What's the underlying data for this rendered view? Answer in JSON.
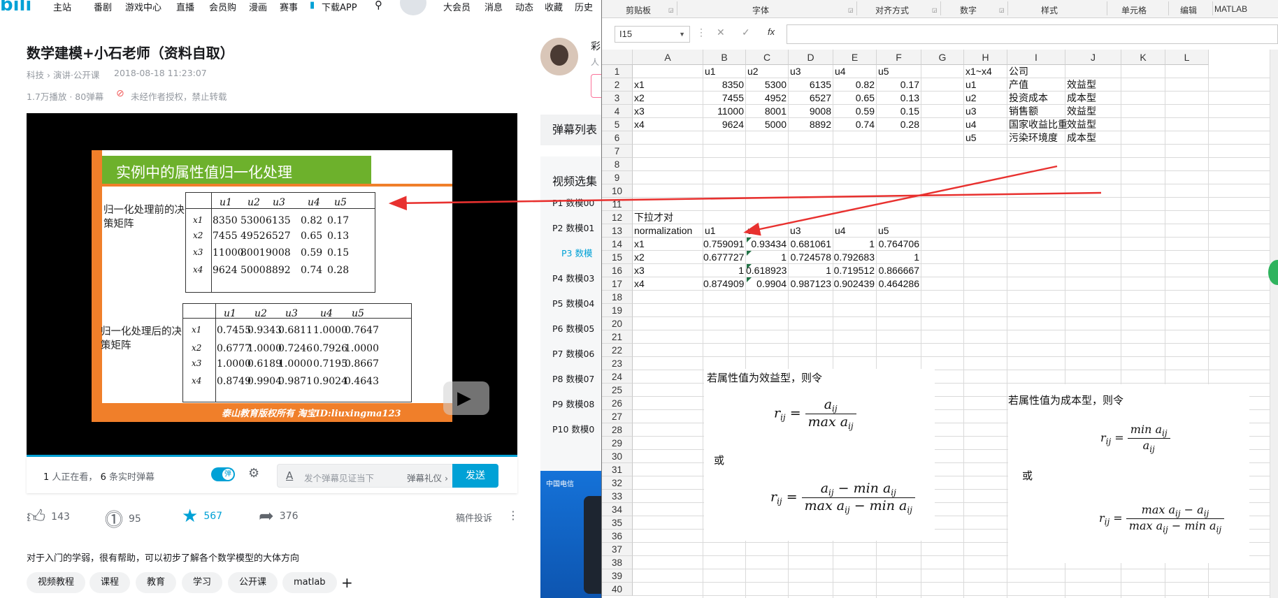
{
  "colors": {
    "accent": "#00a1d6",
    "slide_green": "#6db12c",
    "slide_orange": "#f07f2a",
    "arrow_red": "#e8312f",
    "excel_green": "#217346"
  },
  "nav": {
    "logo": "bili",
    "items": [
      "主站",
      "番剧",
      "游戏中心",
      "直播",
      "会员购",
      "漫画",
      "赛事",
      "下载APP",
      "大会员",
      "消息",
      "动态",
      "收藏",
      "历史"
    ],
    "icons": [
      "phone-icon",
      "search-icon",
      "avatar"
    ]
  },
  "video": {
    "title": "数学建模+小石老师（资料自取）",
    "category": "科技 › 演讲·公开课",
    "date": "2018-08-18 11:23:07",
    "stats": "1.7万播放 · 80弹幕",
    "notice": "未经作者授权，禁止转载"
  },
  "slide": {
    "title": "实例中的属性值归一化处理",
    "label_before": "归一化处理前的决策矩阵",
    "label_after": "归一化处理后的决策矩阵",
    "headers": [
      "u1",
      "u2",
      "u3",
      "u4",
      "u5"
    ],
    "rows": [
      "x1",
      "x2",
      "x3",
      "x4"
    ],
    "before": [
      [
        "8350",
        "5300",
        "6135",
        "0.82",
        "0.17"
      ],
      [
        "7455",
        "4952",
        "6527",
        "0.65",
        "0.13"
      ],
      [
        "11000",
        "8001",
        "9008",
        "0.59",
        "0.15"
      ],
      [
        "9624",
        "5000",
        "8892",
        "0.74",
        "0.28"
      ]
    ],
    "after": [
      [
        "0.7455",
        "0.9343",
        "0.6811",
        "1.0000",
        "0.7647"
      ],
      [
        "0.6777",
        "1.0000",
        "0.7246",
        "0.7926",
        "1.0000"
      ],
      [
        "1.0000",
        "0.6189",
        "1.0000",
        "0.7195",
        "0.8667"
      ],
      [
        "0.8749",
        "0.9904",
        "0.9871",
        "0.9024",
        "0.4643"
      ]
    ],
    "footer": "泰山教育版权所有  淘宝ID:liuxingma123"
  },
  "danmaku": {
    "watching": "1",
    "watching_text": "人正在看，",
    "live": "6",
    "live_text": "条实时弹幕",
    "toggle": "弹",
    "placeholder": "发个弹幕见证当下",
    "gift": "弹幕礼仪 ›",
    "send": "发送"
  },
  "actions": {
    "like": "143",
    "coin": "95",
    "fav": "567",
    "share": "376",
    "report": "稿件投诉"
  },
  "description": "对于入门的学弱，很有帮助，可以初步了解各个数学模型的大体方向",
  "tags": [
    "视频教程",
    "课程",
    "教育",
    "学习",
    "公开课",
    "matlab",
    "+"
  ],
  "right_panel": {
    "up_name": "彩",
    "up_sub": "人",
    "danmaku_list": "弹幕列表",
    "video_select": "视频选集",
    "episodes": [
      "P1  数模00",
      "P2  数模01",
      "P3  数模",
      "P4  数模03",
      "P5  数模04",
      "P6  数模05",
      "P7  数模06",
      "P8  数模07",
      "P9  数模08",
      "P10  数模0"
    ],
    "current_episode": 2,
    "ad_text": "中国电信"
  },
  "excel": {
    "ribbon": [
      "剪贴板",
      "字体",
      "对齐方式",
      "数字",
      "样式",
      "单元格",
      "编辑",
      "MATLAB"
    ],
    "name_box": "I15",
    "columns": [
      "A",
      "B",
      "C",
      "D",
      "E",
      "F",
      "G",
      "H",
      "I",
      "J",
      "K",
      "L"
    ],
    "rows": [
      "1",
      "2",
      "3",
      "4",
      "5",
      "6",
      "7",
      "8",
      "9",
      "10",
      "11",
      "12",
      "13",
      "14",
      "15",
      "16",
      "17",
      "18",
      "19",
      "20",
      "21",
      "22",
      "23",
      "24",
      "25",
      "26",
      "27",
      "28",
      "29",
      "30",
      "31",
      "32",
      "33",
      "34",
      "35",
      "36",
      "37",
      "38",
      "39",
      "40"
    ],
    "header_row": [
      "",
      "u1",
      "u2",
      "u3",
      "u4",
      "u5"
    ],
    "data": [
      [
        "x1",
        "8350",
        "5300",
        "6135",
        "0.82",
        "0.17"
      ],
      [
        "x2",
        "7455",
        "4952",
        "6527",
        "0.65",
        "0.13"
      ],
      [
        "x3",
        "11000",
        "8001",
        "9008",
        "0.59",
        "0.15"
      ],
      [
        "x4",
        "9624",
        "5000",
        "8892",
        "0.74",
        "0.28"
      ]
    ],
    "legend": [
      [
        "x1~x4",
        "公司",
        ""
      ],
      [
        "u1",
        "产值",
        "效益型"
      ],
      [
        "u2",
        "投资成本",
        "成本型"
      ],
      [
        "u3",
        "销售额",
        "效益型"
      ],
      [
        "u4",
        "国家收益比重",
        "效益型"
      ],
      [
        "u5",
        "污染环境度",
        "成本型"
      ]
    ],
    "note12": "下拉才对",
    "norm_header": [
      "normalization",
      "u1",
      "u2",
      "u3",
      "u4",
      "u5"
    ],
    "norm": [
      [
        "x1",
        "0.759091",
        "0.93434",
        "0.681061",
        "1",
        "0.764706"
      ],
      [
        "x2",
        "0.677727",
        "1",
        "0.724578",
        "0.792683",
        "1"
      ],
      [
        "x3",
        "1",
        "0.618923",
        "1",
        "0.719512",
        "0.866667"
      ],
      [
        "x4",
        "0.874909",
        "0.9904",
        "0.987123",
        "0.902439",
        "0.464286"
      ]
    ],
    "benefit_text": "若属性值为效益型，则令",
    "cost_text": "若属性值为成本型，则令",
    "or_text": "或"
  }
}
